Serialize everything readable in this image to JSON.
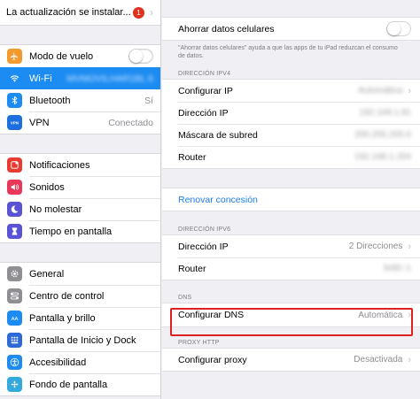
{
  "left": {
    "update_row": {
      "label": "La actualización se instalar...",
      "badge": "1"
    },
    "group_connectivity": [
      {
        "label": "Modo de vuelo",
        "icon": "airplane-icon",
        "color": "#f29a2e",
        "control": "toggle",
        "value": ""
      },
      {
        "label": "Wi-Fi",
        "icon": "wifi-icon",
        "color": "#1d8cf2",
        "control": "value",
        "value": "MVMOVILHAR1BL 6",
        "selected": true
      },
      {
        "label": "Bluetooth",
        "icon": "bluetooth-icon",
        "color": "#1d8cf2",
        "control": "value",
        "value": "Sí"
      },
      {
        "label": "VPN",
        "icon": "vpn-icon",
        "color": "#1d6fe0",
        "control": "value",
        "value": "Conectado"
      }
    ],
    "group_notifications": [
      {
        "label": "Notificaciones",
        "icon": "notifications-icon",
        "color": "#ea3b30"
      },
      {
        "label": "Sonidos",
        "icon": "sounds-icon",
        "color": "#ea3658"
      },
      {
        "label": "No molestar",
        "icon": "moon-icon",
        "color": "#5b53d6"
      },
      {
        "label": "Tiempo en pantalla",
        "icon": "hourglass-icon",
        "color": "#5b53d6"
      }
    ],
    "group_general": [
      {
        "label": "General",
        "icon": "gear-icon",
        "color": "#8e8e93"
      },
      {
        "label": "Centro de control",
        "icon": "control-center-icon",
        "color": "#8e8e93"
      },
      {
        "label": "Pantalla y brillo",
        "icon": "brightness-icon",
        "color": "#1d8cf2"
      },
      {
        "label": "Pantalla de Inicio y Dock",
        "icon": "home-screen-icon",
        "color": "#2d6ad8"
      },
      {
        "label": "Accesibilidad",
        "icon": "accessibility-icon",
        "color": "#1d8cf2"
      },
      {
        "label": "Fondo de pantalla",
        "icon": "wallpaper-icon",
        "color": "#33aadc"
      }
    ]
  },
  "right": {
    "low_data": {
      "label": "Ahorrar datos celulares",
      "footnote": "\"Ahorrar datos celulares\" ayuda a que las apps de tu iPad reduzcan el consumo de datos."
    },
    "ipv4": {
      "header": "DIRECCIÓN IPV4",
      "rows": [
        {
          "label": "Configurar IP",
          "value": "Automática",
          "chevron": true
        },
        {
          "label": "Dirección IP",
          "value": "192.168.1.81"
        },
        {
          "label": "Máscara de subred",
          "value": "255.255.255.0"
        },
        {
          "label": "Router",
          "value": "192.168.1.254"
        }
      ]
    },
    "renew": {
      "label": "Renovar concesión"
    },
    "ipv6": {
      "header": "DIRECCIÓN IPV6",
      "rows": [
        {
          "label": "Dirección IP",
          "value": "2 Direcciones",
          "chevron": true
        },
        {
          "label": "Router",
          "value": "fe80::1"
        }
      ]
    },
    "dns": {
      "header": "DNS",
      "label": "Configurar DNS",
      "value": "Automática"
    },
    "proxy": {
      "header": "PROXY HTTP",
      "label": "Configurar proxy",
      "value": "Desactivada"
    }
  },
  "colors": {
    "accent": "#1d8cf2",
    "highlight": "#e02020",
    "badge": "#e0301e"
  }
}
